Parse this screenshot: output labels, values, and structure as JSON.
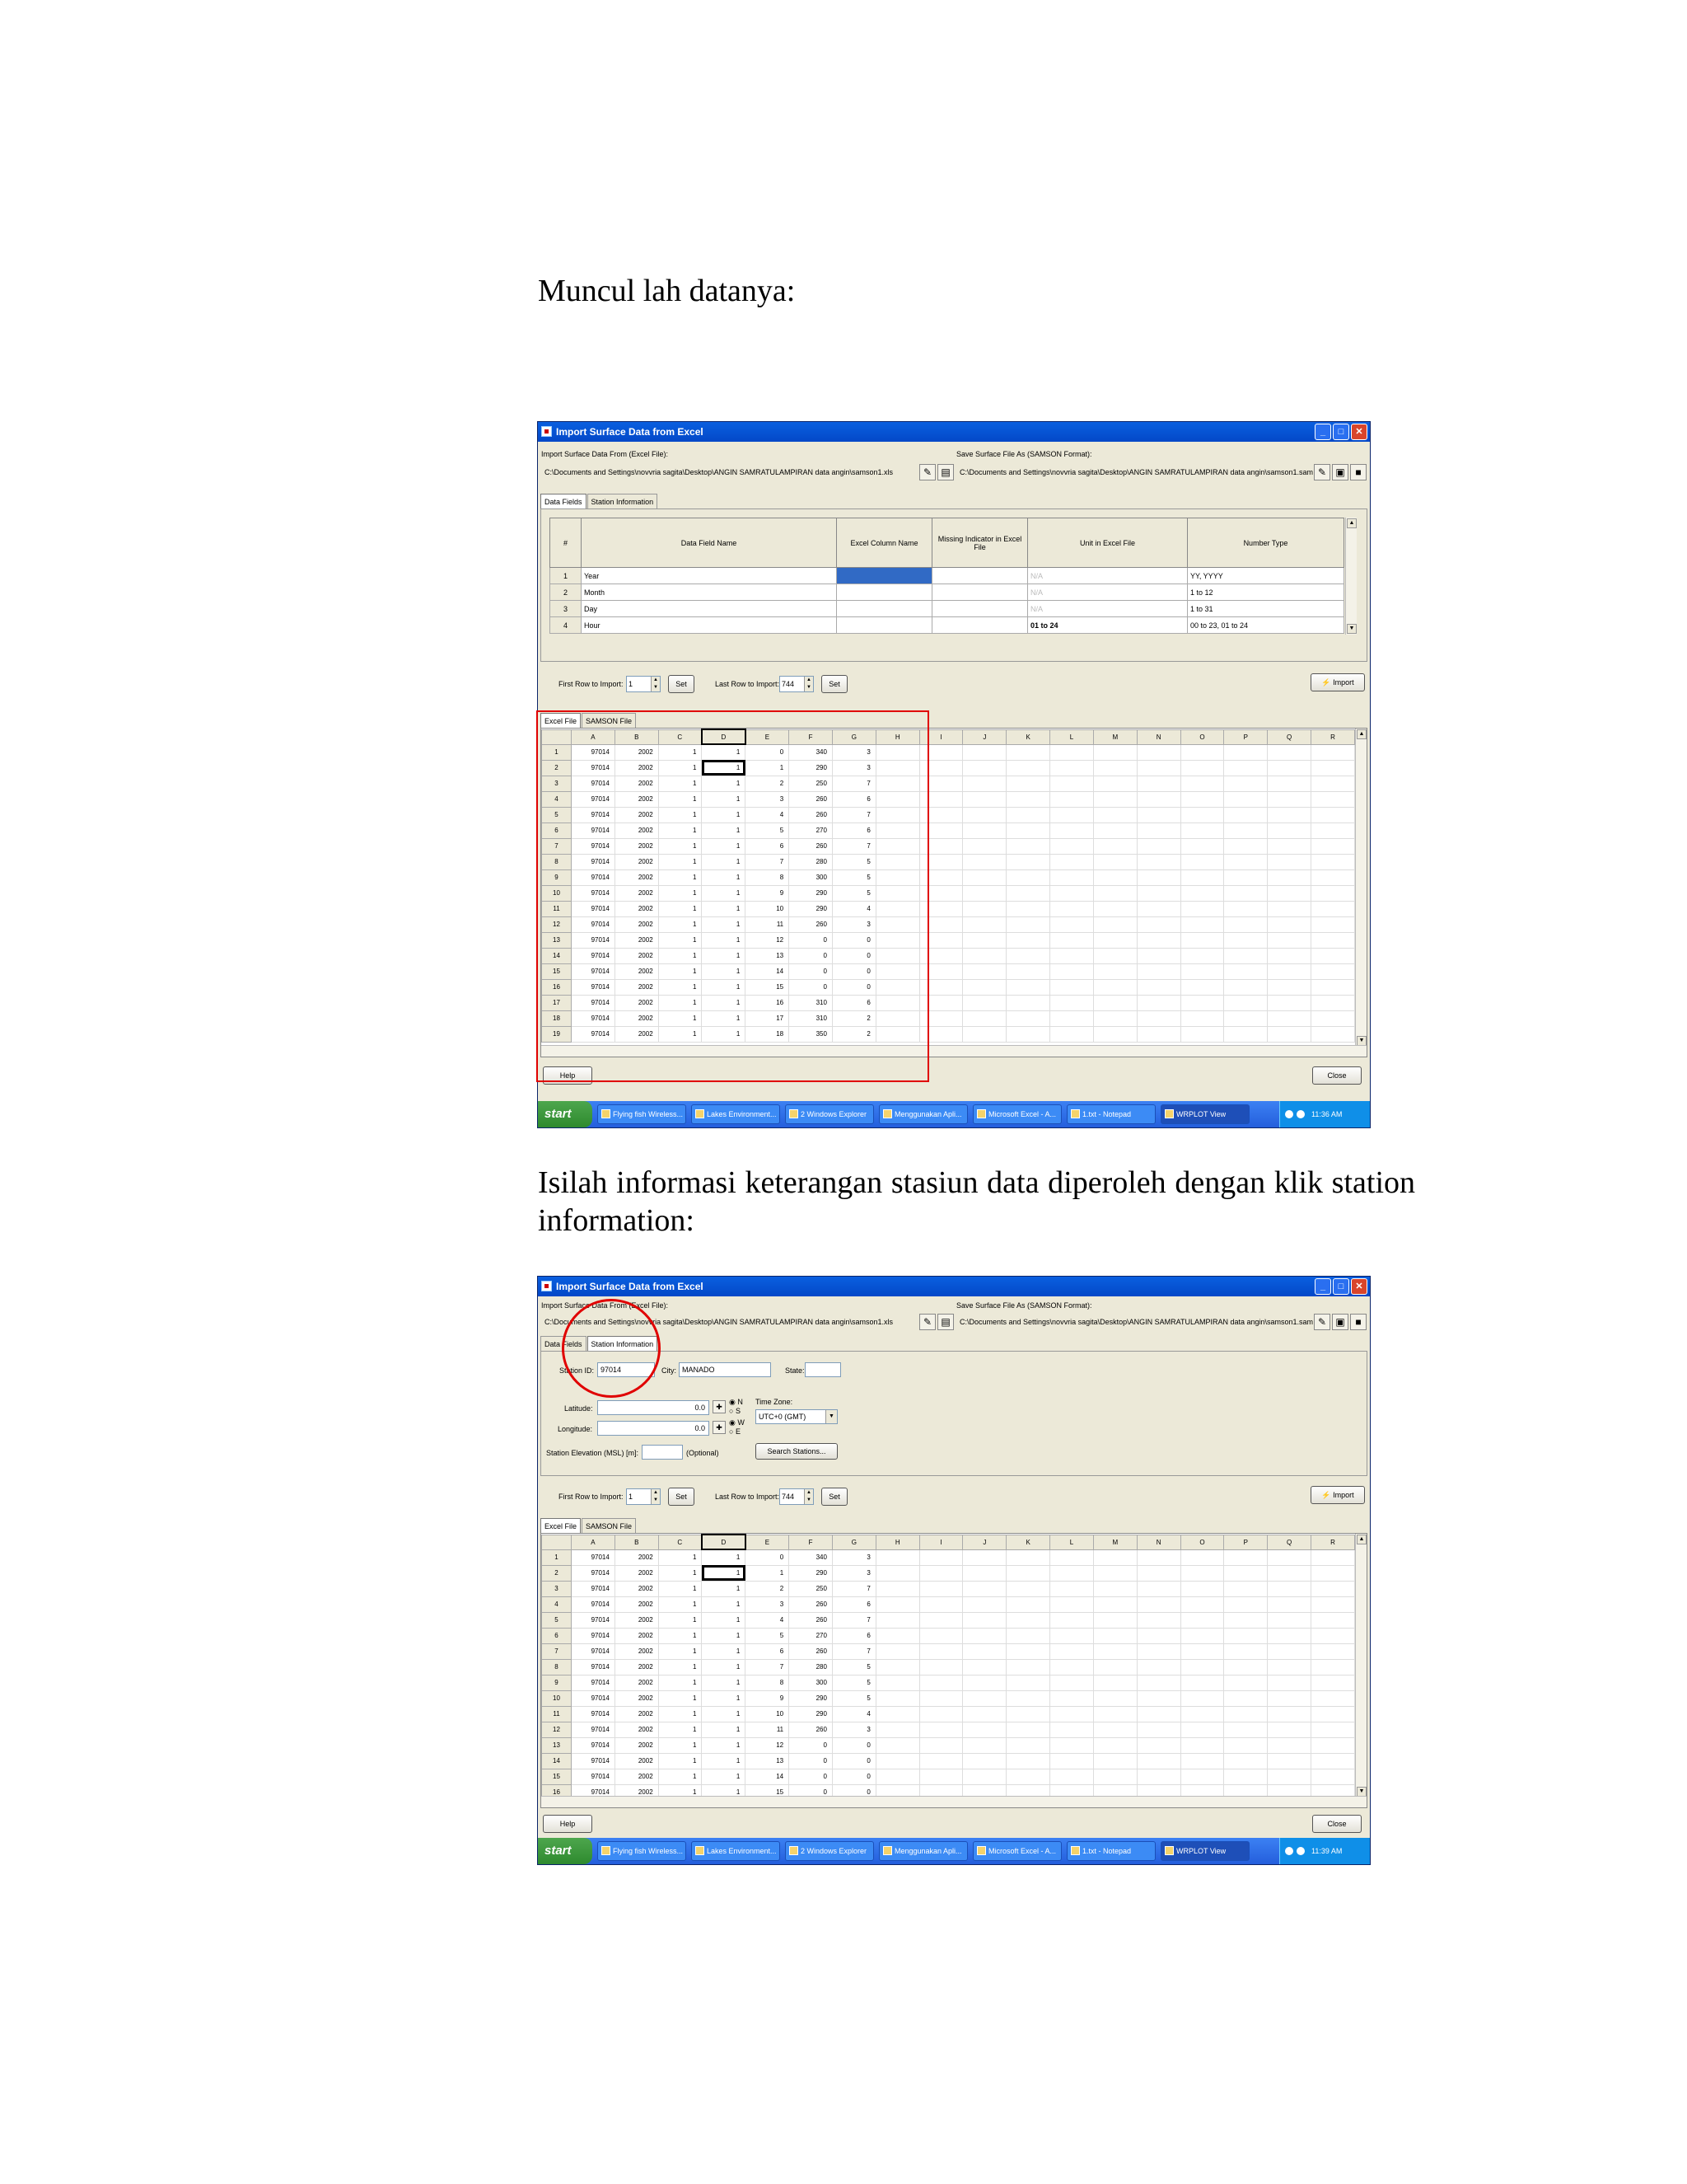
{
  "text": {
    "intro": "Muncul lah datanya:",
    "instruction": "Isilah informasi keterangan stasiun data diperoleh dengan klik station information:"
  },
  "colors": {
    "highlight": "#e00000",
    "titlebar": "#0A5FE0",
    "dialog_bg": "#ECE9D8"
  },
  "dialog": {
    "title": "Import Surface Data from Excel",
    "import_label": "Import Surface Data From (Excel File):",
    "import_path": "C:\\Documents and Settings\\novvria sagita\\Desktop\\ANGIN SAMRATULAMPIRAN data angin\\samson1.xls",
    "save_label": "Save Surface File As (SAMSON Format):",
    "save_path": "C:\\Documents and Settings\\novvria sagita\\Desktop\\ANGIN SAMRATULAMPIRAN data angin\\samson1.sam",
    "tab_data_fields": "Data Fields",
    "tab_station_info": "Station Information",
    "headers": [
      "#",
      "Data Field Name",
      "Excel Column Name",
      "Missing Indicator in Excel File",
      "Unit in Excel File",
      "Number Type"
    ],
    "fields": [
      {
        "num": "1",
        "name": "Year",
        "unit": "N/A",
        "type": "YY, YYYY"
      },
      {
        "num": "2",
        "name": "Month",
        "unit": "N/A",
        "type": "1 to 12"
      },
      {
        "num": "3",
        "name": "Day",
        "unit": "N/A",
        "type": "1 to 31"
      },
      {
        "num": "4",
        "name": "Hour",
        "unit": "01 to 24",
        "type": "00 to 23, 01 to 24"
      }
    ],
    "first_row_label": "First Row to Import:",
    "first_row_value": "1",
    "last_row_label": "Last Row to Import:",
    "last_row_value": "744",
    "set_label": "Set",
    "import_button": "Import",
    "tab_excel": "Excel File",
    "tab_samson": "SAMSON File",
    "columns": [
      "A",
      "B",
      "C",
      "D",
      "E",
      "F",
      "G",
      "H",
      "I",
      "J",
      "K",
      "L",
      "M",
      "N",
      "O",
      "P",
      "Q",
      "R"
    ],
    "rows": [
      [
        "97014",
        "2002",
        "1",
        "1",
        "0",
        "340",
        "3"
      ],
      [
        "97014",
        "2002",
        "1",
        "1",
        "1",
        "290",
        "3"
      ],
      [
        "97014",
        "2002",
        "1",
        "1",
        "2",
        "250",
        "7"
      ],
      [
        "97014",
        "2002",
        "1",
        "1",
        "3",
        "260",
        "6"
      ],
      [
        "97014",
        "2002",
        "1",
        "1",
        "4",
        "260",
        "7"
      ],
      [
        "97014",
        "2002",
        "1",
        "1",
        "5",
        "270",
        "6"
      ],
      [
        "97014",
        "2002",
        "1",
        "1",
        "6",
        "260",
        "7"
      ],
      [
        "97014",
        "2002",
        "1",
        "1",
        "7",
        "280",
        "5"
      ],
      [
        "97014",
        "2002",
        "1",
        "1",
        "8",
        "300",
        "5"
      ],
      [
        "97014",
        "2002",
        "1",
        "1",
        "9",
        "290",
        "5"
      ],
      [
        "97014",
        "2002",
        "1",
        "1",
        "10",
        "290",
        "4"
      ],
      [
        "97014",
        "2002",
        "1",
        "1",
        "11",
        "260",
        "3"
      ],
      [
        "97014",
        "2002",
        "1",
        "1",
        "12",
        "0",
        "0"
      ],
      [
        "97014",
        "2002",
        "1",
        "1",
        "13",
        "0",
        "0"
      ],
      [
        "97014",
        "2002",
        "1",
        "1",
        "14",
        "0",
        "0"
      ],
      [
        "97014",
        "2002",
        "1",
        "1",
        "15",
        "0",
        "0"
      ],
      [
        "97014",
        "2002",
        "1",
        "1",
        "16",
        "310",
        "6"
      ],
      [
        "97014",
        "2002",
        "1",
        "1",
        "17",
        "310",
        "2"
      ],
      [
        "97014",
        "2002",
        "1",
        "1",
        "18",
        "350",
        "2"
      ]
    ],
    "help_button": "Help",
    "close_button": "Close",
    "station": {
      "id_label": "Station ID:",
      "id_value": "97014",
      "city_label": "City:",
      "city_value": "MANADO",
      "state_label": "State:",
      "latitude_label": "Latitude:",
      "latitude_value": "0.0",
      "longitude_label": "Longitude:",
      "longitude_value": "0.0",
      "n": "N",
      "s": "S",
      "w": "W",
      "e": "E",
      "timezone_label": "Time Zone:",
      "timezone_value": "UTC+0 (GMT)",
      "elevation_label": "Station Elevation (MSL) [m]:",
      "optional": "(Optional)",
      "search_button": "Search Stations..."
    }
  },
  "taskbar": {
    "start": "start",
    "items": [
      "Flying fish Wireless...",
      "Lakes Environment...",
      "2 Windows Explorer",
      "Menggunakan Apli...",
      "Microsoft Excel - A...",
      "1.txt - Notepad",
      "WRPLOT View"
    ],
    "time1": "11:36 AM",
    "time2": "11:39 AM"
  }
}
